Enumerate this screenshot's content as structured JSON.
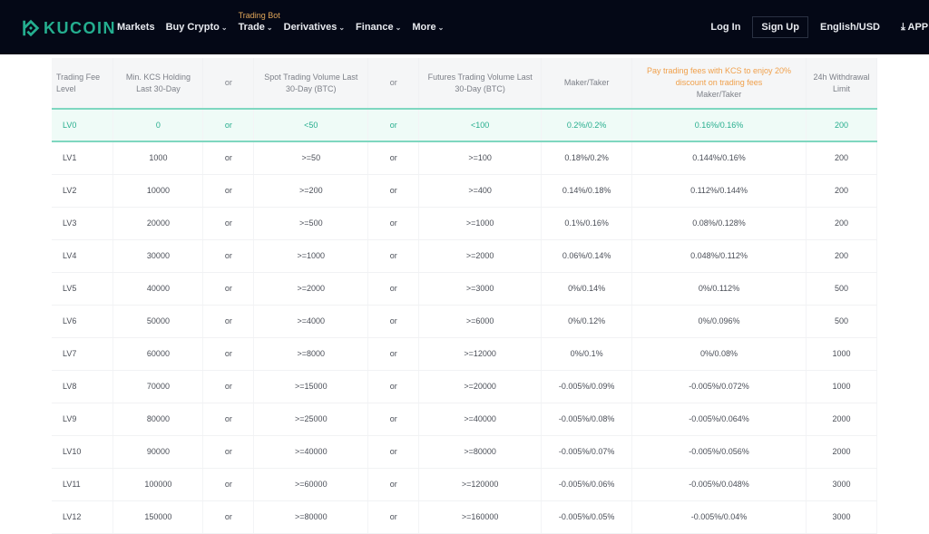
{
  "header": {
    "logo_text": "KUCOIN",
    "nav": [
      {
        "label": "Markets",
        "has_dropdown": false
      },
      {
        "label": "Buy Crypto",
        "has_dropdown": true
      },
      {
        "label": "Trade",
        "has_dropdown": true,
        "badge": "Trading Bot"
      },
      {
        "label": "Derivatives",
        "has_dropdown": true
      },
      {
        "label": "Finance",
        "has_dropdown": true
      },
      {
        "label": "More",
        "has_dropdown": true
      }
    ],
    "login": "Log In",
    "signup": "Sign Up",
    "language": "English/USD",
    "app": "APP"
  },
  "colors": {
    "brand": "#24ae8f",
    "highlight": "#27ae8e",
    "promo": "#f0a04b",
    "header_bg": "#040816"
  },
  "table": {
    "headers": {
      "level": "Trading Fee Level",
      "kcs": "Min. KCS Holding Last 30-Day",
      "or1": "or",
      "spot": "Spot Trading Volume Last 30-Day (BTC)",
      "or2": "or",
      "futures": "Futures Trading Volume Last 30-Day (BTC)",
      "maker_taker": "Maker/Taker",
      "kcs_promo": "Pay trading fees with KCS to enjoy 20% discount on trading fees",
      "kcs_maker_taker": "Maker/Taker",
      "withdrawal": "24h Withdrawal Limit"
    },
    "rows": [
      {
        "level": "LV0",
        "kcs": "0",
        "or1": "or",
        "spot": "<50",
        "or2": "or",
        "futures": "<100",
        "fee": "0.2%/0.2%",
        "kcs_fee": "0.16%/0.16%",
        "limit": "200"
      },
      {
        "level": "LV1",
        "kcs": "1000",
        "or1": "or",
        "spot": ">=50",
        "or2": "or",
        "futures": ">=100",
        "fee": "0.18%/0.2%",
        "kcs_fee": "0.144%/0.16%",
        "limit": "200"
      },
      {
        "level": "LV2",
        "kcs": "10000",
        "or1": "or",
        "spot": ">=200",
        "or2": "or",
        "futures": ">=400",
        "fee": "0.14%/0.18%",
        "kcs_fee": "0.112%/0.144%",
        "limit": "200"
      },
      {
        "level": "LV3",
        "kcs": "20000",
        "or1": "or",
        "spot": ">=500",
        "or2": "or",
        "futures": ">=1000",
        "fee": "0.1%/0.16%",
        "kcs_fee": "0.08%/0.128%",
        "limit": "200"
      },
      {
        "level": "LV4",
        "kcs": "30000",
        "or1": "or",
        "spot": ">=1000",
        "or2": "or",
        "futures": ">=2000",
        "fee": "0.06%/0.14%",
        "kcs_fee": "0.048%/0.112%",
        "limit": "200"
      },
      {
        "level": "LV5",
        "kcs": "40000",
        "or1": "or",
        "spot": ">=2000",
        "or2": "or",
        "futures": ">=3000",
        "fee": "0%/0.14%",
        "kcs_fee": "0%/0.112%",
        "limit": "500"
      },
      {
        "level": "LV6",
        "kcs": "50000",
        "or1": "or",
        "spot": ">=4000",
        "or2": "or",
        "futures": ">=6000",
        "fee": "0%/0.12%",
        "kcs_fee": "0%/0.096%",
        "limit": "500"
      },
      {
        "level": "LV7",
        "kcs": "60000",
        "or1": "or",
        "spot": ">=8000",
        "or2": "or",
        "futures": ">=12000",
        "fee": "0%/0.1%",
        "kcs_fee": "0%/0.08%",
        "limit": "1000"
      },
      {
        "level": "LV8",
        "kcs": "70000",
        "or1": "or",
        "spot": ">=15000",
        "or2": "or",
        "futures": ">=20000",
        "fee": "-0.005%/0.09%",
        "kcs_fee": "-0.005%/0.072%",
        "limit": "1000"
      },
      {
        "level": "LV9",
        "kcs": "80000",
        "or1": "or",
        "spot": ">=25000",
        "or2": "or",
        "futures": ">=40000",
        "fee": "-0.005%/0.08%",
        "kcs_fee": "-0.005%/0.064%",
        "limit": "2000"
      },
      {
        "level": "LV10",
        "kcs": "90000",
        "or1": "or",
        "spot": ">=40000",
        "or2": "or",
        "futures": ">=80000",
        "fee": "-0.005%/0.07%",
        "kcs_fee": "-0.005%/0.056%",
        "limit": "2000"
      },
      {
        "level": "LV11",
        "kcs": "100000",
        "or1": "or",
        "spot": ">=60000",
        "or2": "or",
        "futures": ">=120000",
        "fee": "-0.005%/0.06%",
        "kcs_fee": "-0.005%/0.048%",
        "limit": "3000"
      },
      {
        "level": "LV12",
        "kcs": "150000",
        "or1": "or",
        "spot": ">=80000",
        "or2": "or",
        "futures": ">=160000",
        "fee": "-0.005%/0.05%",
        "kcs_fee": "-0.005%/0.04%",
        "limit": "3000"
      }
    ],
    "active_row": 0
  }
}
